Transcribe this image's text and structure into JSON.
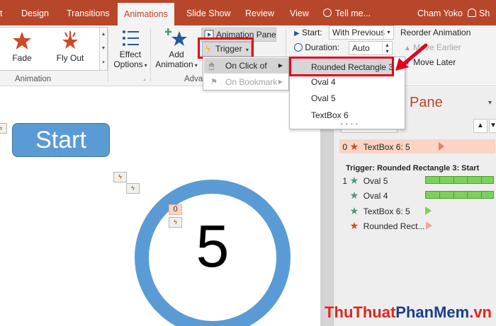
{
  "tabs": [
    {
      "label": "t"
    },
    {
      "label": "Design"
    },
    {
      "label": "Transitions"
    },
    {
      "label": "Animations",
      "active": true
    },
    {
      "label": "Slide Show"
    },
    {
      "label": "Review"
    },
    {
      "label": "View"
    }
  ],
  "tellme": "Tell me...",
  "user": "Cham Yoko",
  "share": "Sh",
  "gallery": {
    "items": [
      "Fade",
      "Fly Out"
    ],
    "group_label": "Animation"
  },
  "effect_options": {
    "line1": "Effect",
    "line2": "Options"
  },
  "add_animation": {
    "line1": "Add",
    "line2": "Animation"
  },
  "advanced_group_label": "Adva",
  "animation_pane_btn": "Animation Pane",
  "trigger_btn": "Trigger",
  "timing": {
    "start_label": "Start:",
    "start_value": "With Previous",
    "duration_label": "Duration:",
    "duration_value": "Auto",
    "reorder_label": "Reorder Animation",
    "move_earlier": "Move Earlier",
    "move_later": "Move Later"
  },
  "trigger_menu": {
    "on_click_of": "On Click of",
    "on_bookmark": "On Bookmark"
  },
  "submenu": {
    "items": [
      "Rounded Rectangle 3",
      "Oval 4",
      "Oval 5",
      "TextBox 6"
    ]
  },
  "slide": {
    "start_text": "Start",
    "ring_text": "5",
    "tag_number": "0"
  },
  "pane": {
    "title": "Pane",
    "row0": {
      "index": "0",
      "label": "TextBox 6: 5"
    },
    "trigger_header": "Trigger: Rounded Rectangle 3: Start",
    "rows": [
      {
        "index": "1",
        "label": "Oval 5"
      },
      {
        "index": "",
        "label": "Oval 4"
      },
      {
        "index": "",
        "label": "TextBox 6: 5"
      },
      {
        "index": "",
        "label": "Rounded Rect..."
      }
    ]
  },
  "watermark": {
    "part1": "ThuThuat",
    "part2": "PhanMem",
    "part3": ".vn"
  },
  "colors": {
    "accent": "#b7472a",
    "highlight_red": "#e5001b",
    "shape_blue": "#5b9bd5",
    "timeline_green": "#7cd158"
  }
}
